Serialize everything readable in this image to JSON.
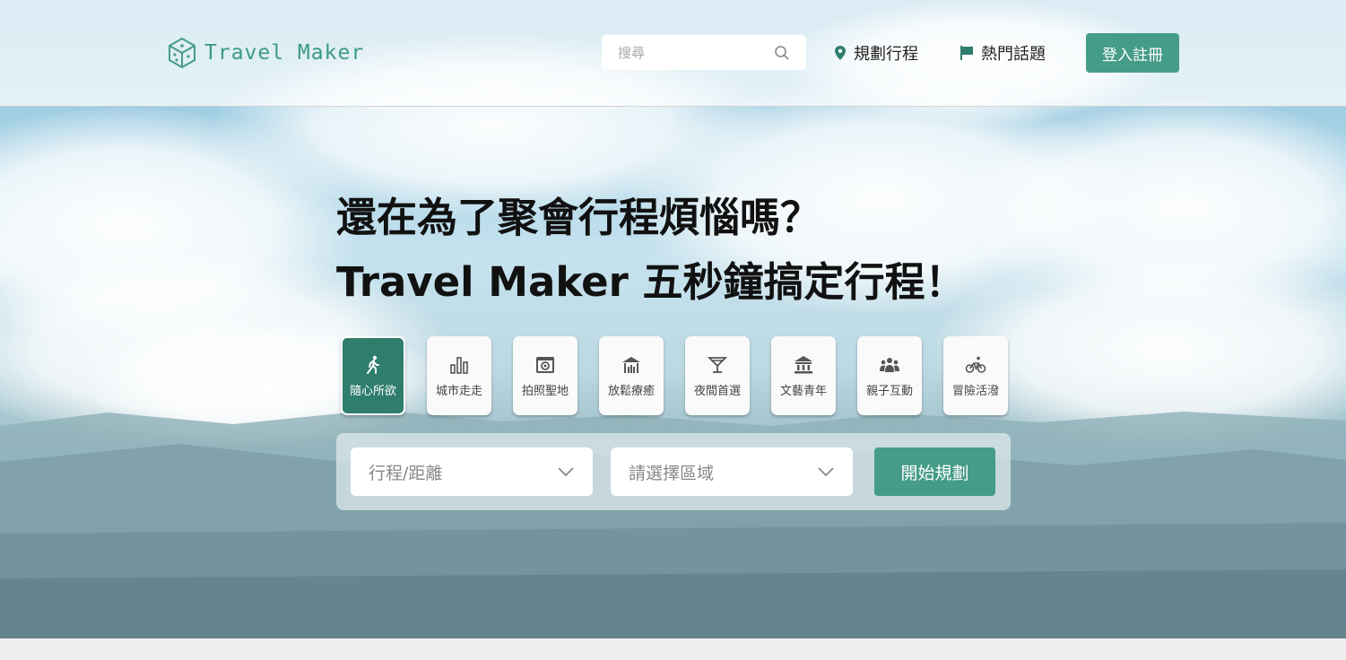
{
  "brand": {
    "name": "Travel Maker",
    "color": "#459c88",
    "icon": "dice-cube-icon"
  },
  "search": {
    "placeholder": "搜尋",
    "icon": "search-icon"
  },
  "nav": [
    {
      "label": "規劃行程",
      "icon": "location-pin-icon"
    },
    {
      "label": "熱門話題",
      "icon": "flag-icon"
    }
  ],
  "auth": {
    "login_label": "登入註冊"
  },
  "hero": {
    "line1": "還在為了聚會行程煩惱嗎？",
    "line2": "Travel Maker 五秒鐘搞定行程！"
  },
  "categories": [
    {
      "label": "隨心所欲",
      "icon": "walking-icon",
      "active": true
    },
    {
      "label": "城市走走",
      "icon": "city-bars-icon",
      "active": false
    },
    {
      "label": "拍照聖地",
      "icon": "camera-icon",
      "active": false
    },
    {
      "label": "放鬆療癒",
      "icon": "gazebo-icon",
      "active": false
    },
    {
      "label": "夜間首選",
      "icon": "cocktail-icon",
      "active": false
    },
    {
      "label": "文藝青年",
      "icon": "museum-icon",
      "active": false
    },
    {
      "label": "親子互動",
      "icon": "family-icon",
      "active": false
    },
    {
      "label": "冒險活潑",
      "icon": "bicycle-icon",
      "active": false
    }
  ],
  "planner": {
    "duration_placeholder": "行程/距離",
    "region_placeholder": "請選擇區域",
    "start_label": "開始規劃"
  }
}
